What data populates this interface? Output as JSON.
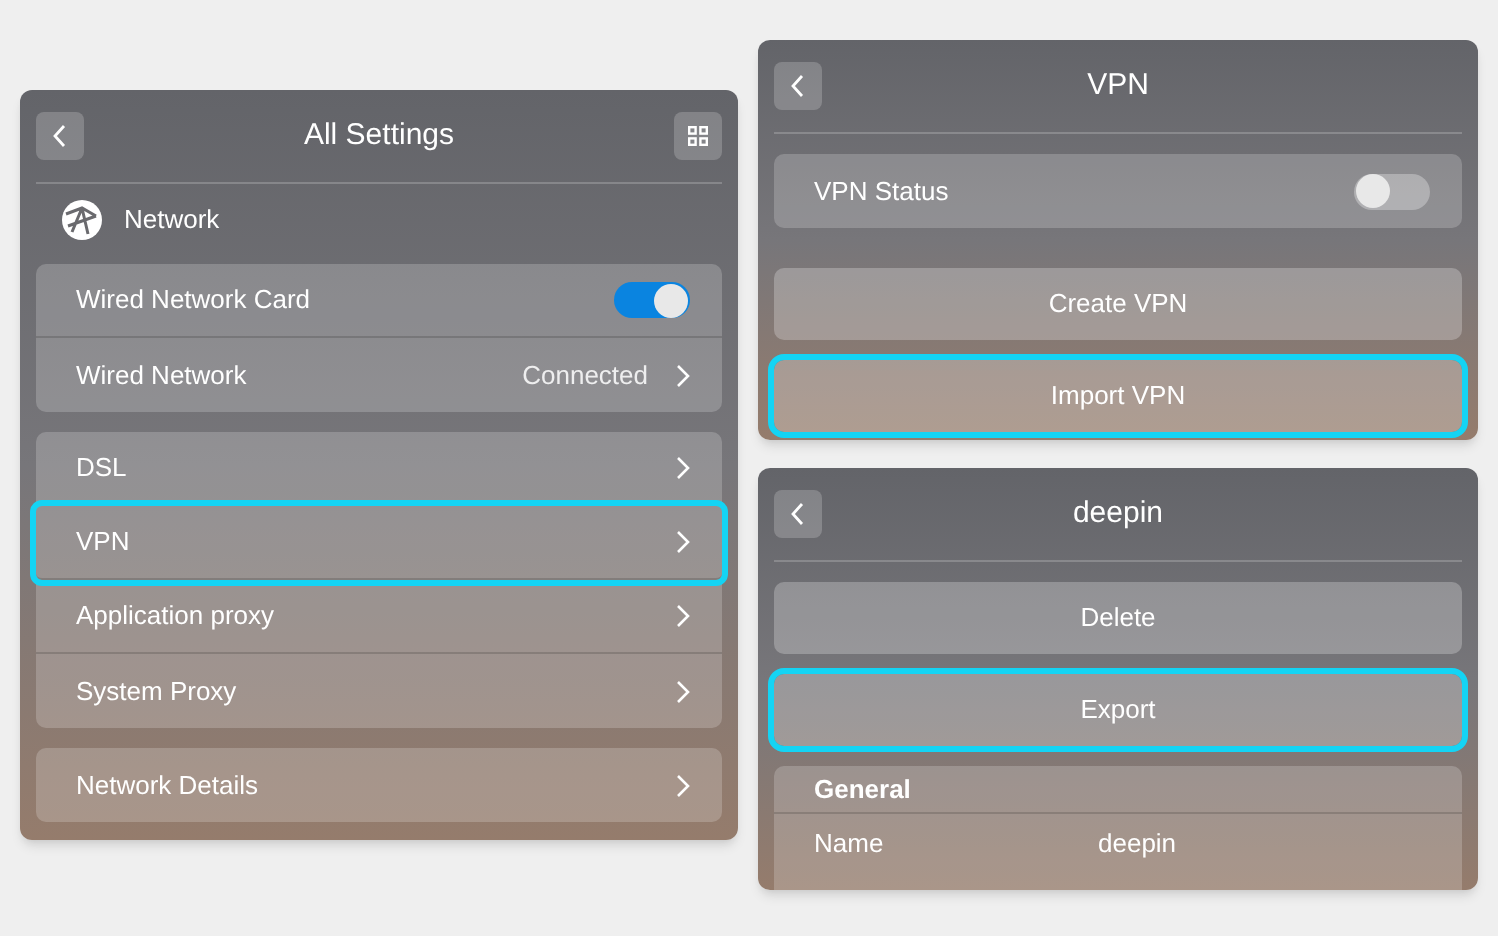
{
  "settings_panel": {
    "title": "All Settings",
    "section": "Network",
    "groups": [
      [
        {
          "kind": "toggle",
          "label": "Wired Network Card",
          "on": true,
          "highlighted": false
        },
        {
          "kind": "link",
          "label": "Wired Network",
          "value": "Connected",
          "highlighted": false
        }
      ],
      [
        {
          "kind": "link",
          "label": "DSL",
          "highlighted": false
        },
        {
          "kind": "link",
          "label": "VPN",
          "highlighted": true
        },
        {
          "kind": "link",
          "label": "Application proxy",
          "highlighted": false
        },
        {
          "kind": "link",
          "label": "System Proxy",
          "highlighted": false
        }
      ],
      [
        {
          "kind": "link",
          "label": "Network Details",
          "highlighted": false
        }
      ]
    ]
  },
  "vpn_panel": {
    "title": "VPN",
    "groups": [
      [
        {
          "kind": "toggle",
          "label": "VPN Status",
          "on": false,
          "highlighted": false
        }
      ]
    ],
    "buttons": [
      {
        "label": "Create VPN",
        "highlighted": false
      },
      {
        "label": "Import VPN",
        "highlighted": true
      }
    ]
  },
  "connection_panel": {
    "title": "deepin",
    "buttons": [
      {
        "label": "Delete",
        "highlighted": false
      },
      {
        "label": "Export",
        "highlighted": true
      }
    ],
    "section": "General",
    "fields": [
      {
        "label": "Name",
        "value": "deepin"
      }
    ]
  }
}
